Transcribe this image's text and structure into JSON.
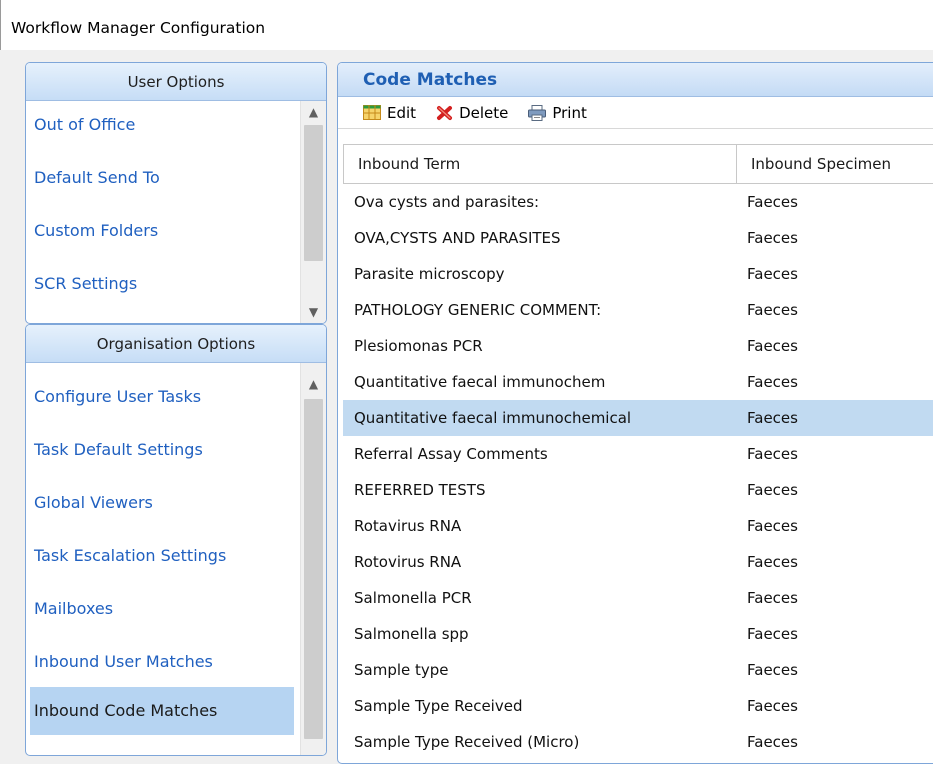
{
  "window": {
    "title": "Workflow Manager Configuration"
  },
  "user_options": {
    "header": "User Options",
    "items": [
      "Out of Office",
      "Default Send To",
      "Custom Folders",
      "SCR Settings"
    ]
  },
  "organisation_options": {
    "header": "Organisation Options",
    "items": [
      "Configure User Tasks",
      "Task Default Settings",
      "Global Viewers",
      "Task Escalation Settings",
      "Mailboxes",
      "Inbound User Matches",
      "Inbound Code Matches"
    ],
    "selected": "Inbound Code Matches"
  },
  "main": {
    "title": "Code Matches",
    "toolbar": {
      "edit": "Edit",
      "delete": "Delete",
      "print": "Print"
    },
    "columns": {
      "term": "Inbound Term",
      "specimen": "Inbound Specimen"
    },
    "rows": [
      {
        "term": "Ova cysts and parasites:",
        "specimen": "Faeces"
      },
      {
        "term": "OVA,CYSTS AND PARASITES",
        "specimen": "Faeces"
      },
      {
        "term": "Parasite microscopy",
        "specimen": "Faeces"
      },
      {
        "term": "PATHOLOGY GENERIC COMMENT:",
        "specimen": "Faeces"
      },
      {
        "term": "Plesiomonas PCR",
        "specimen": "Faeces"
      },
      {
        "term": "Quantitative faecal immunochem",
        "specimen": "Faeces"
      },
      {
        "term": "Quantitative faecal immunochemical",
        "specimen": "Faeces"
      },
      {
        "term": "Referral Assay Comments",
        "specimen": "Faeces"
      },
      {
        "term": "REFERRED TESTS",
        "specimen": "Faeces"
      },
      {
        "term": "Rotavirus RNA",
        "specimen": "Faeces"
      },
      {
        "term": "Rotovirus RNA",
        "specimen": "Faeces"
      },
      {
        "term": "Salmonella PCR",
        "specimen": "Faeces"
      },
      {
        "term": "Salmonella spp",
        "specimen": "Faeces"
      },
      {
        "term": "Sample type",
        "specimen": "Faeces"
      },
      {
        "term": "Sample Type Received",
        "specimen": "Faeces"
      },
      {
        "term": "Sample Type Received (Micro)",
        "specimen": "Faeces"
      }
    ],
    "selected_row": "Quantitative faecal immunochemical"
  },
  "icons": {
    "edit": "grid-edit-icon",
    "delete": "red-x-delete-icon",
    "print": "printer-icon"
  },
  "colors": {
    "link": "#2060c0",
    "selection": "#c1daf1",
    "header_title": "#1f5fb3"
  }
}
